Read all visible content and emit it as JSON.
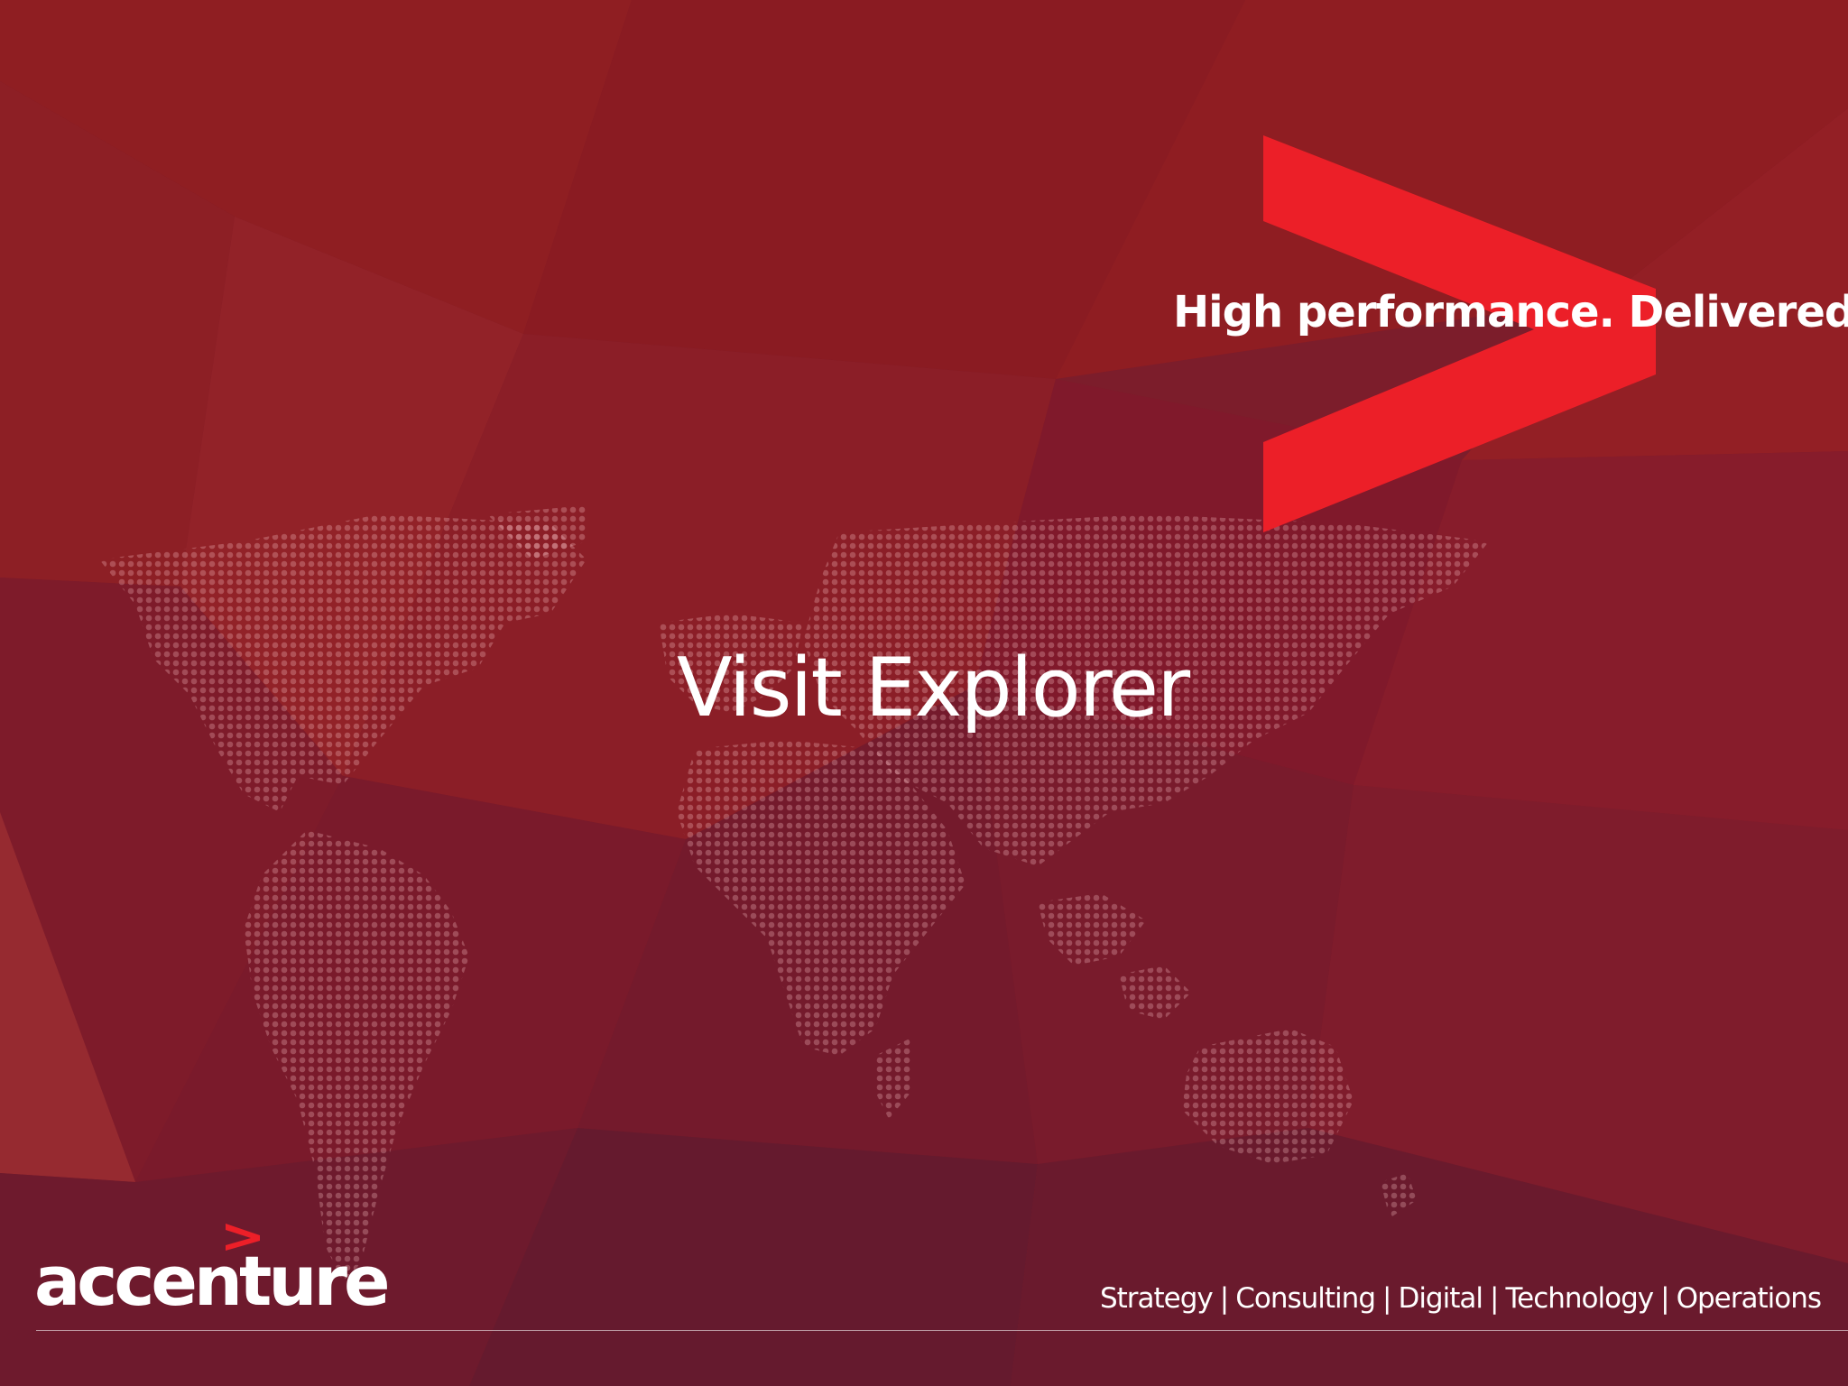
{
  "brand": {
    "logo_text": "accenture",
    "tagline": "High performance. Delivered.",
    "accent_color": "#ec1f28",
    "logo_icon": "chevron-icon"
  },
  "slide": {
    "title": "Visit Explorer"
  },
  "footer": {
    "services": [
      "Strategy",
      "Consulting",
      "Digital",
      "Technology",
      "Operations"
    ],
    "separator": "|"
  },
  "background": {
    "base_color": "#7a1c2a",
    "map_icon": "world-map-icon"
  }
}
